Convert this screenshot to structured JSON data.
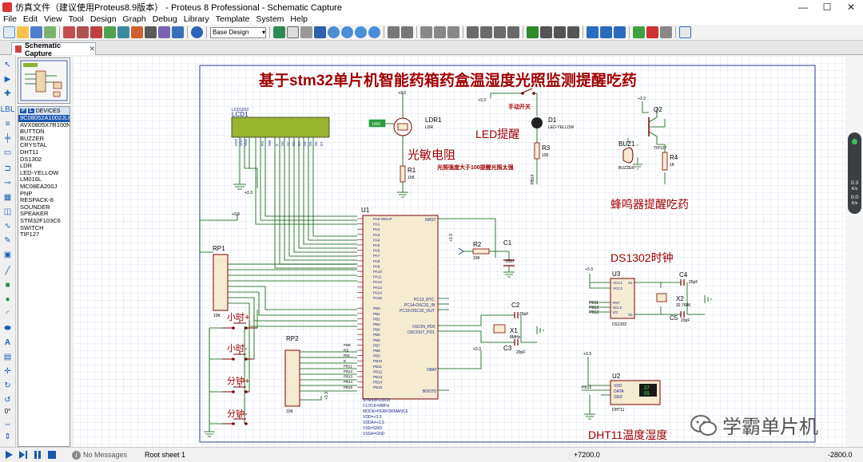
{
  "window": {
    "title": "仿真文件（建议使用Proteus8.9版本） - Proteus 8 Professional - Schematic Capture",
    "min": "—",
    "max": "☐",
    "close": "✕"
  },
  "menu": [
    "File",
    "Edit",
    "View",
    "Tool",
    "Design",
    "Graph",
    "Debug",
    "Library",
    "Template",
    "System",
    "Help"
  ],
  "toolbar": {
    "design_select": "Base Design"
  },
  "tab": {
    "label": "Schematic Capture",
    "close": "✕"
  },
  "devices": {
    "header": "DEVICES",
    "p_label": "P",
    "l_label": "L",
    "items": [
      "9C08052A1002JLH",
      "AVX0805X7R100N",
      "BUTTON",
      "BUZZER",
      "CRYSTAL",
      "DHT11",
      "DS1302",
      "LDR",
      "LED-YELLOW",
      "LM016L",
      "MC08EA200J",
      "PNP",
      "RESPACK-8",
      "SOUNDER",
      "SPEAKER",
      "STM32F103C6",
      "SWITCH",
      "TIP127"
    ],
    "selected_index": 0
  },
  "left_tools": {
    "zero_label": "0°"
  },
  "schematic": {
    "title": "基于stm32单片机智能药箱药盒温湿度光照监测提醒吃药",
    "labels": {
      "lcd_name": "LCD1",
      "lcd_part": "LCD1602",
      "ldr_text": "光敏电阻",
      "ldr_name": "LDR1",
      "ldr_part": "LDR",
      "led_text": "LED提醒",
      "d1_name": "D1",
      "d1_part": "LED-YELLOW",
      "manual_switch": "手动开关",
      "light_note": "光照强度大于100提醒光照太强",
      "buzzer_text": "蜂鸣器提醒吃药",
      "buz_name": "BUZ1",
      "buz_part": "BUZZER",
      "q2_name": "Q2",
      "q2_part": "TIP127",
      "r4": "R4",
      "r4_val": "1K",
      "r1": "R1",
      "r1_val": "10K",
      "r3": "R3",
      "r3_val": "100",
      "u1": "U1",
      "u1_part": "STM32F103C6",
      "u1_clock": "CLOCK=8MHz",
      "u1_mode": "MODE=PERFORMANCE",
      "u1_vdd": "VDD=+3.3",
      "u1_vdda": "VDDA=+3.3",
      "u1_vss": "VSS=GND",
      "u1_vssa": "VSSA=GND",
      "rp1": "RP1",
      "rp1_val": "10K",
      "rp2": "RP2",
      "rp2_val": "10K",
      "btn_hour_plus": "小时+",
      "btn_hour_minus": "小时-",
      "btn_min_plus": "分钟+",
      "btn_min_minus": "分钟-",
      "r2": "R2",
      "r2_val": "10K",
      "c1": "C1",
      "c1_val": "100n",
      "c2": "C2",
      "c2_val": "20pF",
      "c3": "C3",
      "c3_val": "20pF",
      "x1": "X1",
      "x1_val": "8MHz",
      "ds_text": "DS1302时钟",
      "u3": "U3",
      "u3_part": "DS1302",
      "c4": "C4",
      "c4_val": "20pF",
      "c5": "C5",
      "c5_val": "20pF",
      "x2": "X2",
      "x2_val": "32.768K",
      "dht_text": "DHT11温度湿度",
      "u2": "U2",
      "u2_part": "DHT11",
      "u2_vdd": "VDD",
      "u2_data": "DATA",
      "u2_gnd": "GND",
      "dht_temp": "27",
      "dht_hum": "55",
      "v33": "+3.3",
      "u1_left_pins": [
        "PA0-WKUP",
        "PA1",
        "PA2",
        "PA3",
        "PA4",
        "PA5",
        "PA6",
        "PA7",
        "PA8",
        "PA9",
        "PA10",
        "PA11",
        "PA12",
        "PA13",
        "PA14",
        "PA15",
        "",
        "PB0",
        "PB1",
        "PB2",
        "PB3",
        "PB4",
        "PB5",
        "PB6",
        "PB7",
        "PB8",
        "PB9",
        "PB10",
        "PB11",
        "PB12",
        "PB13",
        "PB14",
        "PB15"
      ],
      "u1_right_top": "NRST",
      "u1_rtc": "PC13_RTC",
      "u1_osc32in": "PC14-OSC32_IN",
      "u1_osc32out": "PC15-OSC32_OUT",
      "u1_oscin": "OSCIN_PD0",
      "u1_oscout": "OSCOUT_PD1",
      "u1_vbat": "VBAT",
      "u1_boot0": "BOOT0",
      "ds_pins_left": [
        "VCC1",
        "VCC2",
        "RST",
        "SCLK",
        "I/O"
      ],
      "ds_x1": "X1",
      "ds_x2": "X2",
      "lcd_pins": [
        "VSS",
        "VDD",
        "VEE",
        "RS",
        "RW",
        "E",
        "D0",
        "D1",
        "D2",
        "D3",
        "D4",
        "D5",
        "D6",
        "D7"
      ],
      "rp2_pins": [
        "PB8",
        "RS",
        "RW",
        "E",
        "PB11",
        "PB12",
        "PB13",
        "PB14",
        "PB15"
      ],
      "ds_pb": [
        "PB11",
        "PB12",
        "PB13"
      ],
      "dht_pb": "PB15",
      "pb14": "PB14"
    }
  },
  "status": {
    "no_messages": "No Messages",
    "sheet": "Root sheet 1",
    "coord_x": "+7200.0",
    "coord_y": "-2800.0"
  },
  "right_widget": {
    "v1": "0.3",
    "v1_unit": "K/s",
    "v2": "0.0",
    "v2_unit": "K/s"
  },
  "watermark": "学霸单片机",
  "colors": {
    "wire": "#005a00",
    "component": "#7a0000",
    "body_fill": "#f5ebd2",
    "title": "#a00000",
    "pin_blue": "#1a2a8c"
  }
}
